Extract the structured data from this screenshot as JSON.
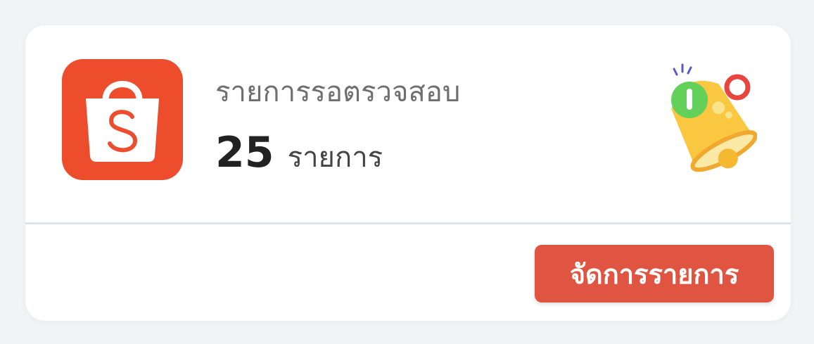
{
  "card": {
    "title": "รายการรอตรวจสอบ",
    "count": "25",
    "unit": "รายการ",
    "manage_button_label": "จัดการรายการ"
  },
  "icons": {
    "app_logo": "shopee-bag-icon",
    "notification": "bell-icon"
  },
  "colors": {
    "brand": "#ee4d2d",
    "button": "#e05541",
    "bell": "#f9c740",
    "badge": "#63d05a"
  }
}
